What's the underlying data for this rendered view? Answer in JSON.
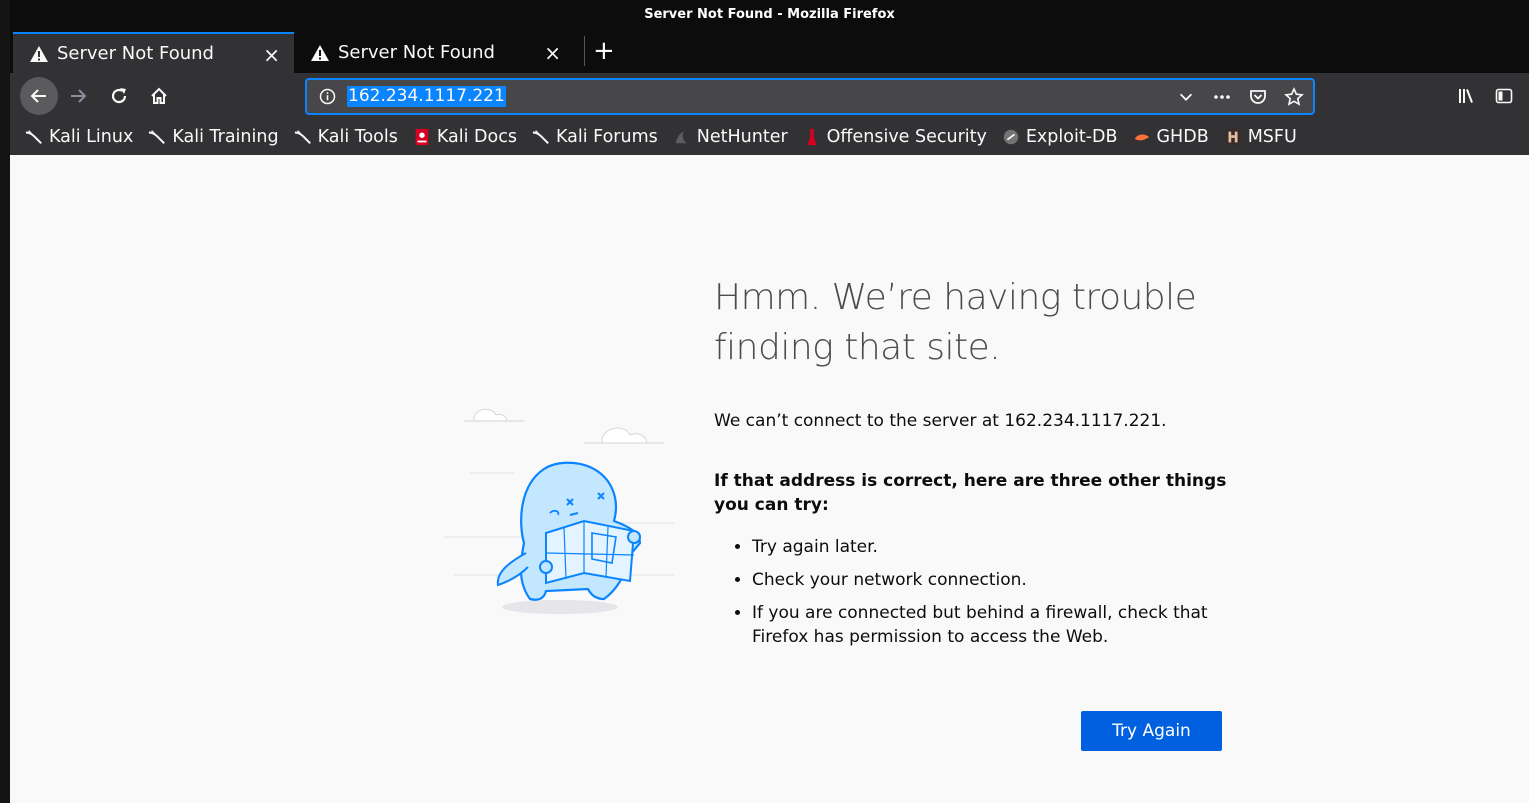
{
  "window": {
    "title": "Server Not Found - Mozilla Firefox"
  },
  "tabs": [
    {
      "label": "Server Not Found",
      "active": true,
      "icon": "warning-icon"
    },
    {
      "label": "Server Not Found",
      "active": false,
      "icon": "warning-icon"
    }
  ],
  "newtab_label": "+",
  "tab_close_glyph": "×",
  "urlbar": {
    "value": "162.234.1117.221"
  },
  "bookmarks": [
    {
      "label": "Kali Linux",
      "icon": "kali-dragon-icon"
    },
    {
      "label": "Kali Training",
      "icon": "kali-dragon-icon"
    },
    {
      "label": "Kali Tools",
      "icon": "kali-dragon-icon"
    },
    {
      "label": "Kali Docs",
      "icon": "kali-docs-icon"
    },
    {
      "label": "Kali Forums",
      "icon": "kali-dragon-icon"
    },
    {
      "label": "NetHunter",
      "icon": "nethunter-icon"
    },
    {
      "label": "Offensive Security",
      "icon": "offsec-icon"
    },
    {
      "label": "Exploit-DB",
      "icon": "exploitdb-icon"
    },
    {
      "label": "GHDB",
      "icon": "ghdb-icon"
    },
    {
      "label": "MSFU",
      "icon": "msfu-icon"
    }
  ],
  "error": {
    "title_line1": "Hmm. We’re having trouble",
    "title_line2": "finding that site.",
    "description": "We can’t connect to the server at 162.234.1117.221.",
    "suggestion_heading": "If that address is correct, here are three other things you can try:",
    "suggestions": [
      "Try again later.",
      "Check your network connection.",
      "If you are connected but behind a firewall, check that Firefox has permission to access the Web."
    ],
    "button_label": "Try Again"
  },
  "colors": {
    "accent": "#0a84ff",
    "button": "#0060df",
    "toolbar": "#323234",
    "content_bg": "#f9f9fa"
  }
}
